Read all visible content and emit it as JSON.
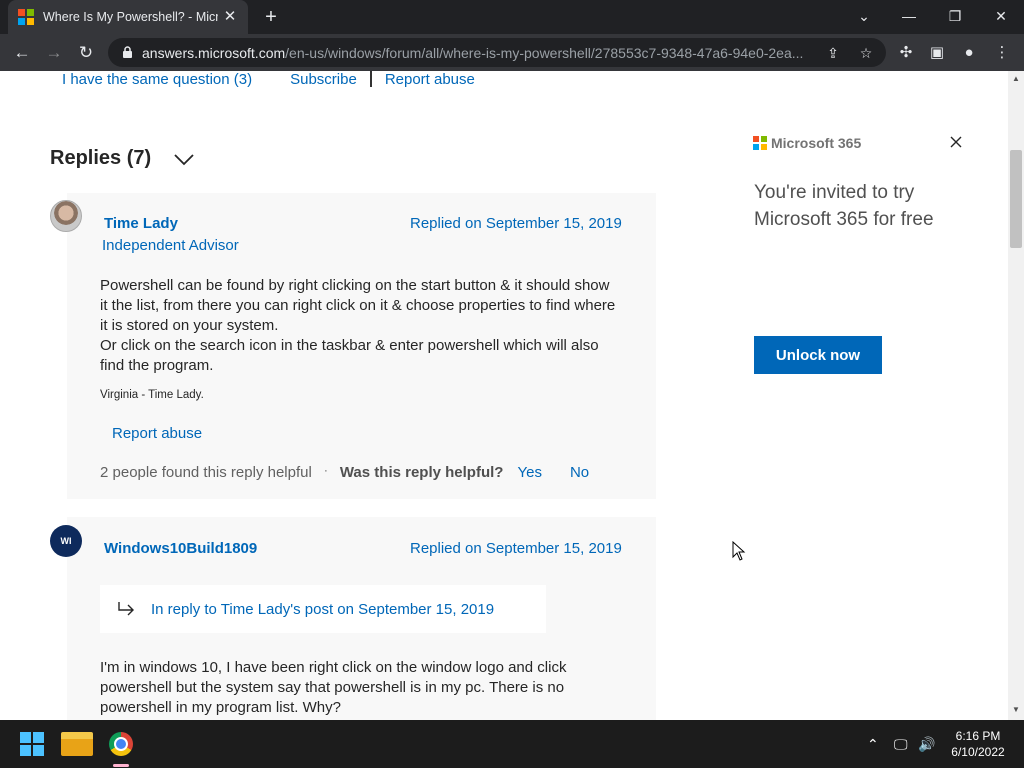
{
  "browser": {
    "tab_title": "Where Is My Powershell? - Micro",
    "url_domain": "answers.microsoft.com",
    "url_path": "/en-us/windows/forum/all/where-is-my-powershell/278553c7-9348-47a6-94e0-2ea..."
  },
  "question_actions": {
    "same_question": "I have the same question (3)",
    "subscribe": "Subscribe",
    "report_abuse": "Report abuse"
  },
  "replies": {
    "heading": "Replies (7)",
    "items": [
      {
        "author": "Time Lady",
        "role": "Independent Advisor",
        "replied_on": "Replied on September 15, 2019",
        "body": [
          "Powershell can be found by right clicking on the start button & it should show",
          "it the list, from there you can right click on it & choose properties to find where",
          "it is stored on your system.",
          "Or click on the search icon in the taskbar & enter powershell which will also",
          "find the program."
        ],
        "signature": "Virginia - Time Lady.",
        "report_abuse": "Report abuse",
        "helpful_count": "2 people found this reply helpful",
        "dot": "·",
        "was_helpful": "Was this reply helpful?",
        "yes": "Yes",
        "no": "No"
      },
      {
        "author": "Windows10Build1809",
        "avatar_initials": "WI",
        "replied_on": "Replied on September 15, 2019",
        "in_reply_to": "In reply to Time Lady's post on September 15, 2019",
        "body": [
          "I'm in windows 10, I have been right click on the window logo and click",
          "powershell but the system say that powershell is in my pc. There is no",
          "powershell in my program list. Why?"
        ]
      }
    ]
  },
  "ad": {
    "brand": "Microsoft 365",
    "headline_line1": "You're invited to try",
    "headline_line2": "Microsoft 365 for free",
    "button": "Unlock now"
  },
  "taskbar": {
    "time": "6:16 PM",
    "date": "6/10/2022"
  },
  "colors": {
    "link": "#0067b8",
    "chrome_dark": "#202124",
    "chrome_mid": "#35363a",
    "taskbar": "#1c1c1c"
  }
}
